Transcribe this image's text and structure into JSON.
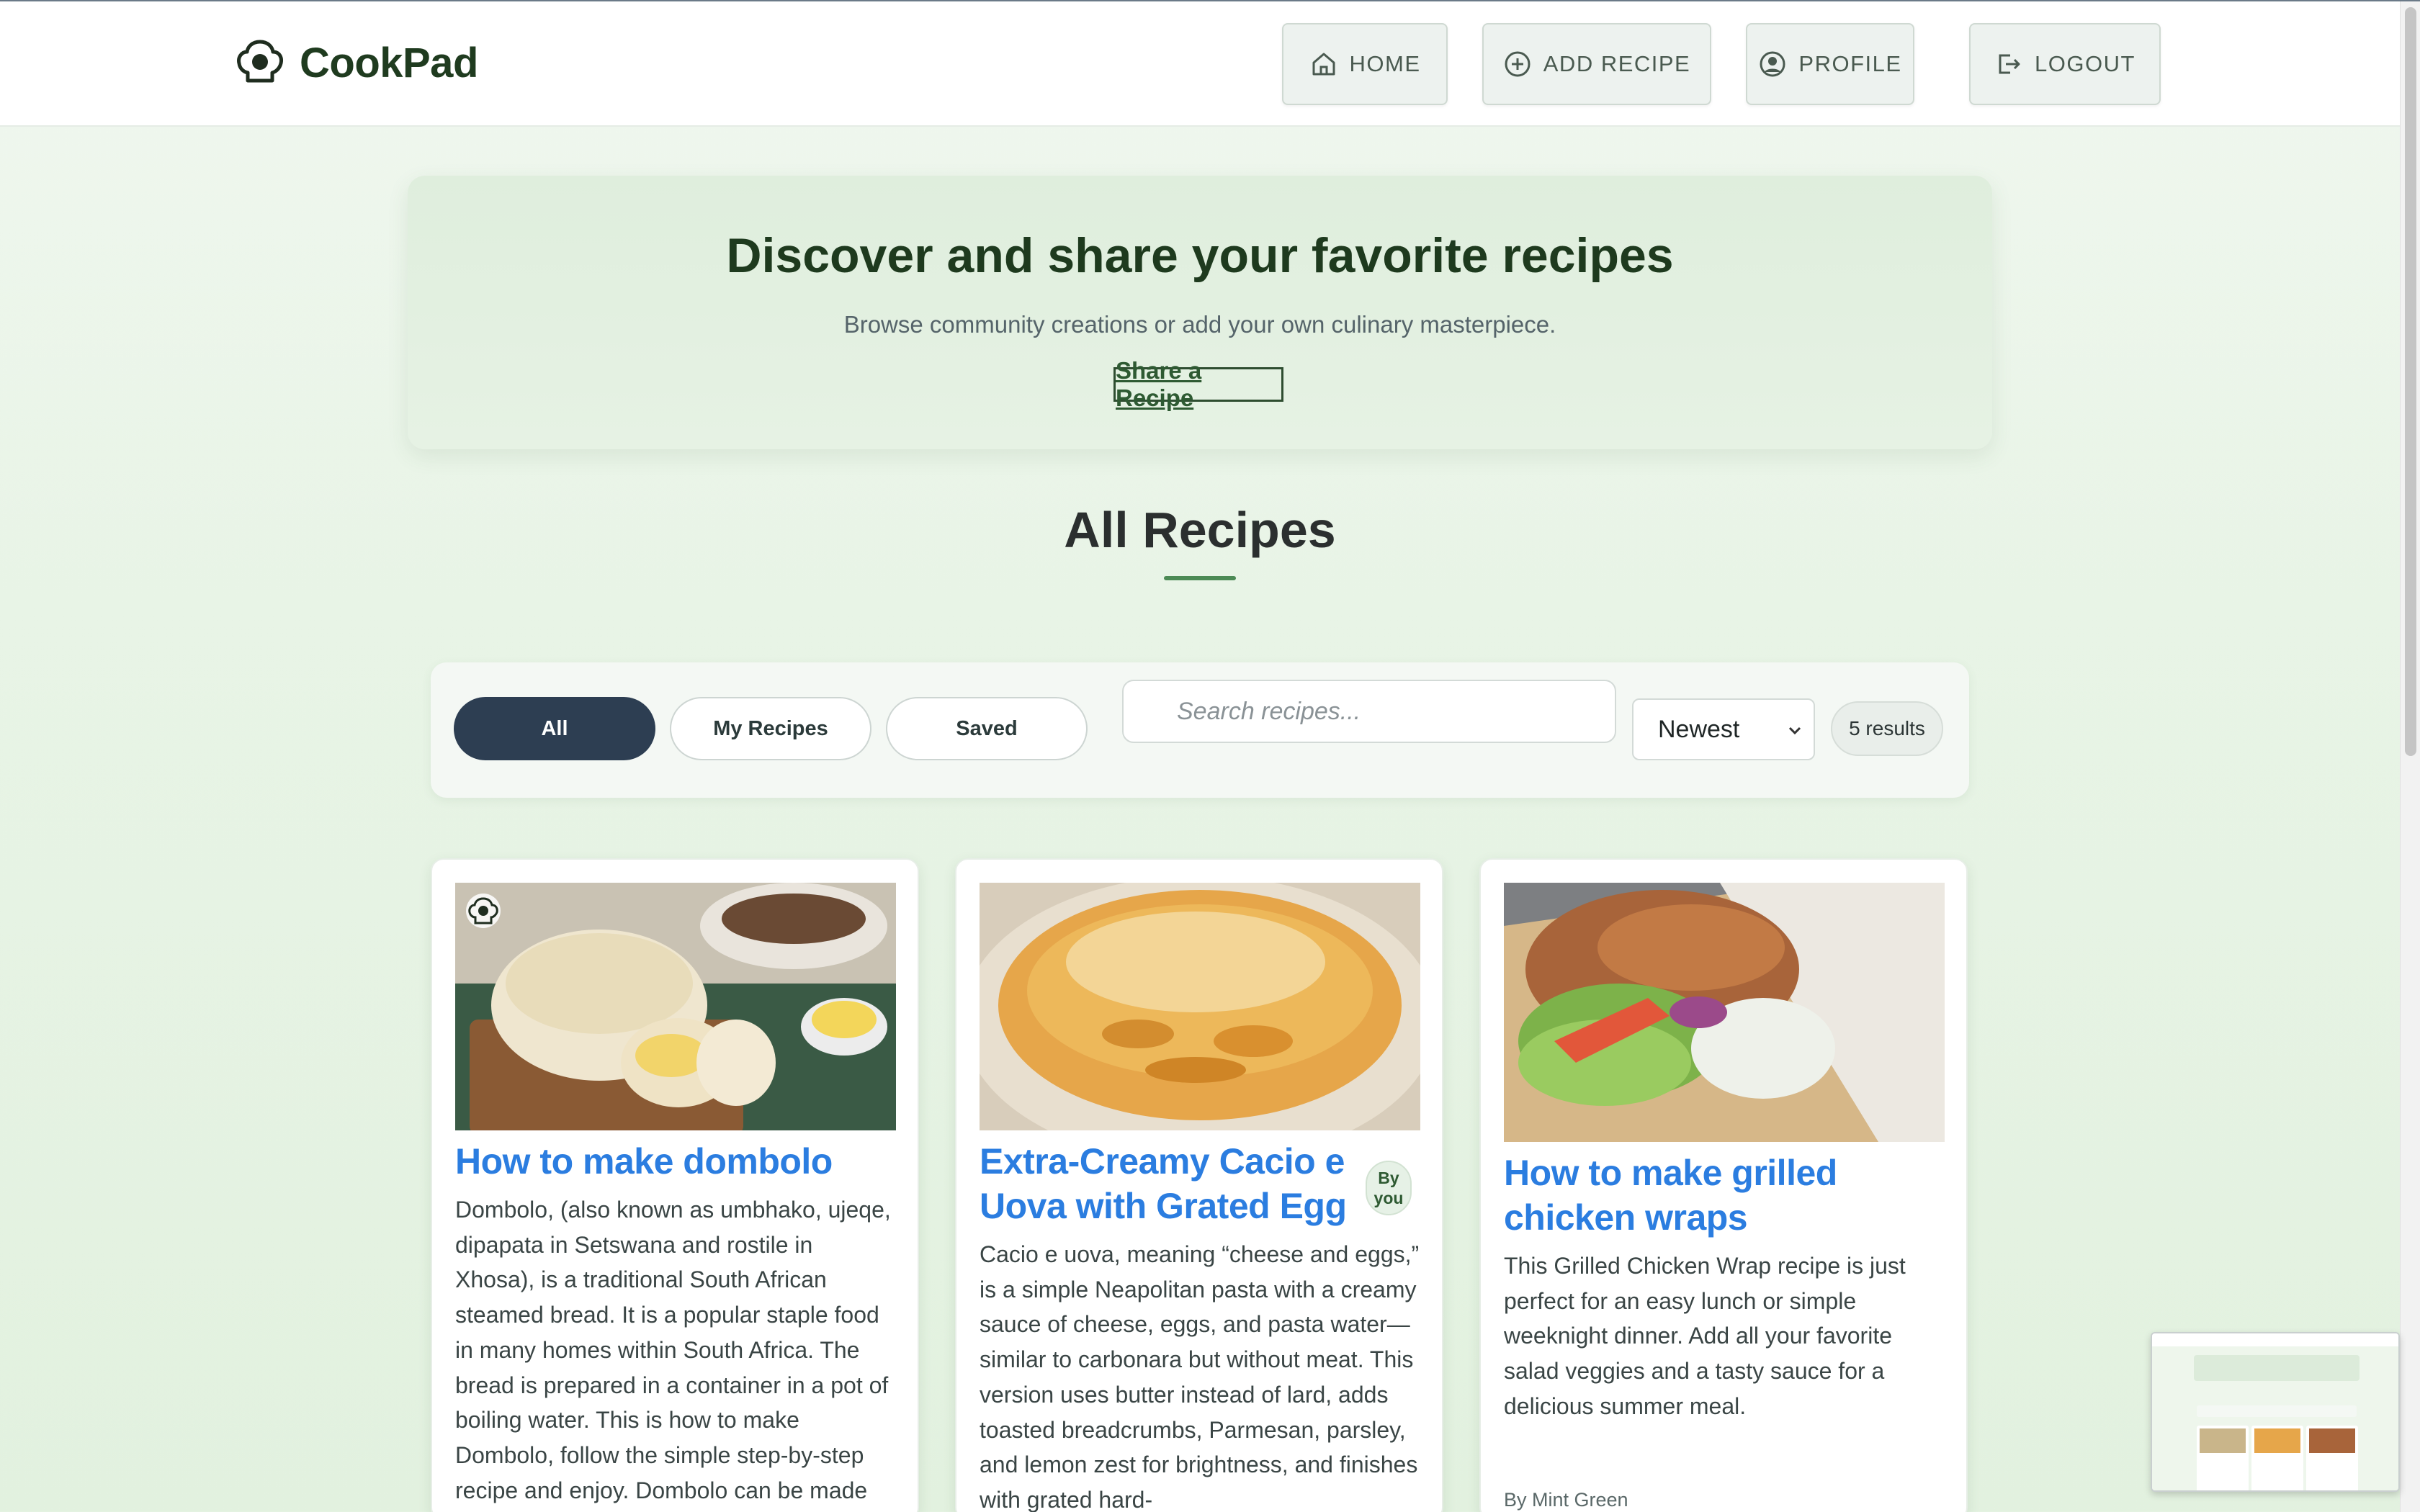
{
  "app": {
    "name": "CookPad"
  },
  "nav": {
    "home": "HOME",
    "add_recipe": "ADD RECIPE",
    "profile": "PROFILE",
    "logout": "LOGOUT"
  },
  "hero": {
    "title": "Discover and share your favorite recipes",
    "subtitle": "Browse community creations or add your own culinary masterpiece.",
    "cta": "Share a Recipe"
  },
  "section": {
    "title": "All Recipes"
  },
  "filters": {
    "tabs": [
      "All",
      "My Recipes",
      "Saved"
    ],
    "active_tab": "All",
    "search_placeholder": "Search recipes...",
    "sort_selected": "Newest",
    "result_count": "5 results"
  },
  "recipes": [
    {
      "title": "How to make dombolo",
      "description": "Dombolo, (also known as umbhako, ujeqe, dipapata in Setswana and rostile in Xhosa), is a traditional South African steamed bread. It is a popular staple food in many homes within South Africa. The bread is prepared in a container in a pot of boiling water. This is how to make Dombolo, follow the simple step-by-step recipe and enjoy. Dombolo can be made",
      "author": "",
      "badge": ""
    },
    {
      "title": "Extra-Creamy Cacio e Uova with Grated Egg",
      "description": "Cacio e uova, meaning “cheese and eggs,” is a simple Neapolitan pasta with a creamy sauce of cheese, eggs, and pasta water—similar to carbonara but without meat. This version uses butter instead of lard, adds toasted breadcrumbs, Parmesan, parsley, and lemon zest for brightness, and finishes with grated hard-",
      "author": "",
      "badge": "By you"
    },
    {
      "title": "How to make grilled chicken wraps",
      "description": "This Grilled Chicken Wrap recipe is just perfect for an easy lunch or simple weeknight dinner. Add all your favorite salad veggies and a tasty sauce for a delicious summer meal.",
      "author": "By Mint Green",
      "badge": ""
    }
  ],
  "colors": {
    "brand_dark": "#1f3b1f",
    "accent_green": "#4c8a55",
    "link_blue": "#2b7de0",
    "active_pill": "#2d3e52"
  }
}
